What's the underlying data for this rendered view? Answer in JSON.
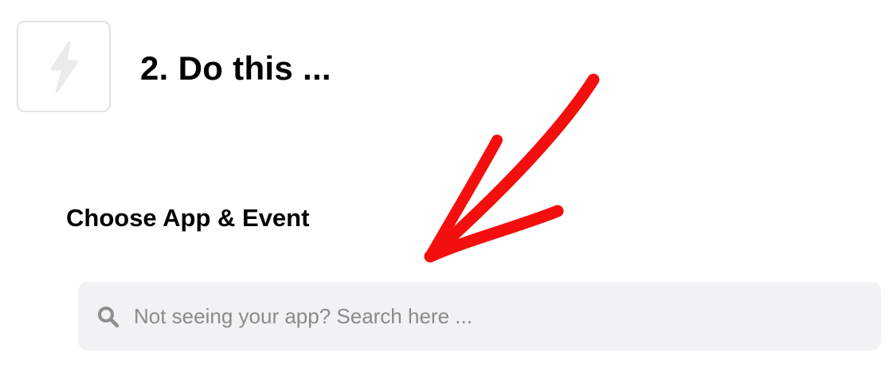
{
  "step": {
    "title": "2. Do this ...",
    "icon": "lightning-bolt-icon"
  },
  "section": {
    "title": "Choose App & Event"
  },
  "search": {
    "placeholder": "Not seeing your app? Search here ...",
    "value": "",
    "icon": "search-icon"
  },
  "annotation": {
    "color": "#f40f0f",
    "shape": "hand-drawn-arrow"
  }
}
